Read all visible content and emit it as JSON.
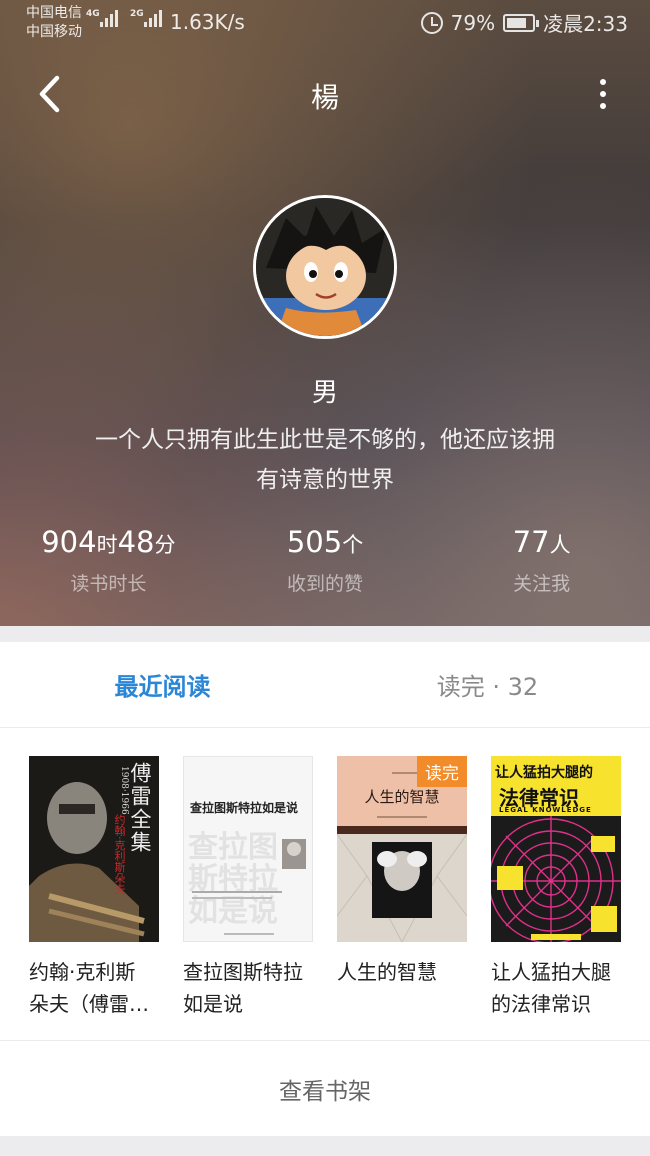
{
  "status_bar": {
    "carrier_1": "中国电信",
    "carrier_2": "中国移动",
    "signal_1_tag": "4G",
    "signal_2_tag": "2G",
    "speed": "1.63K/s",
    "battery": "79%",
    "time": "凌晨2:33"
  },
  "header": {
    "username": "楊"
  },
  "profile": {
    "gender": "男",
    "bio_line_1": "一个人只拥有此生此世是不够的，他还应该拥",
    "bio_line_2": "有诗意的世界"
  },
  "stats": [
    {
      "num_a": "904",
      "unit_a": "时",
      "num_b": "48",
      "unit_b": "分",
      "label": "读书时长"
    },
    {
      "num_a": "505",
      "unit_a": "个",
      "label": "收到的赞"
    },
    {
      "num_a": "77",
      "unit_a": "人",
      "label": "关注我"
    }
  ],
  "tabs": {
    "recent": "最近阅读",
    "finished": "读完 · 32"
  },
  "books": [
    {
      "title_line_1": "约翰·克利斯",
      "title_line_2": "朵夫（傅雷…",
      "cover_text": "傅雷全集",
      "cover_sub": "1908·1966",
      "cover_series": "约翰·克利斯朵夫"
    },
    {
      "title_line_1": "查拉图斯特拉",
      "title_line_2": "如是说",
      "cover_text": "查拉图斯特拉如是说"
    },
    {
      "title_line_1": "人生的智慧",
      "title_line_2": "",
      "cover_text": "人生的智慧",
      "badge": "读完"
    },
    {
      "title_line_1": "让人猛拍大腿",
      "title_line_2": "的法律常识",
      "cover_text_1": "让人猛拍大腿的",
      "cover_text_2": "法律常识",
      "cover_en": "LEGAL KNOWLEDGE"
    }
  ],
  "shelf_link": "查看书架",
  "colors": {
    "accent": "#2b86d6",
    "badge": "#f28c2a"
  }
}
